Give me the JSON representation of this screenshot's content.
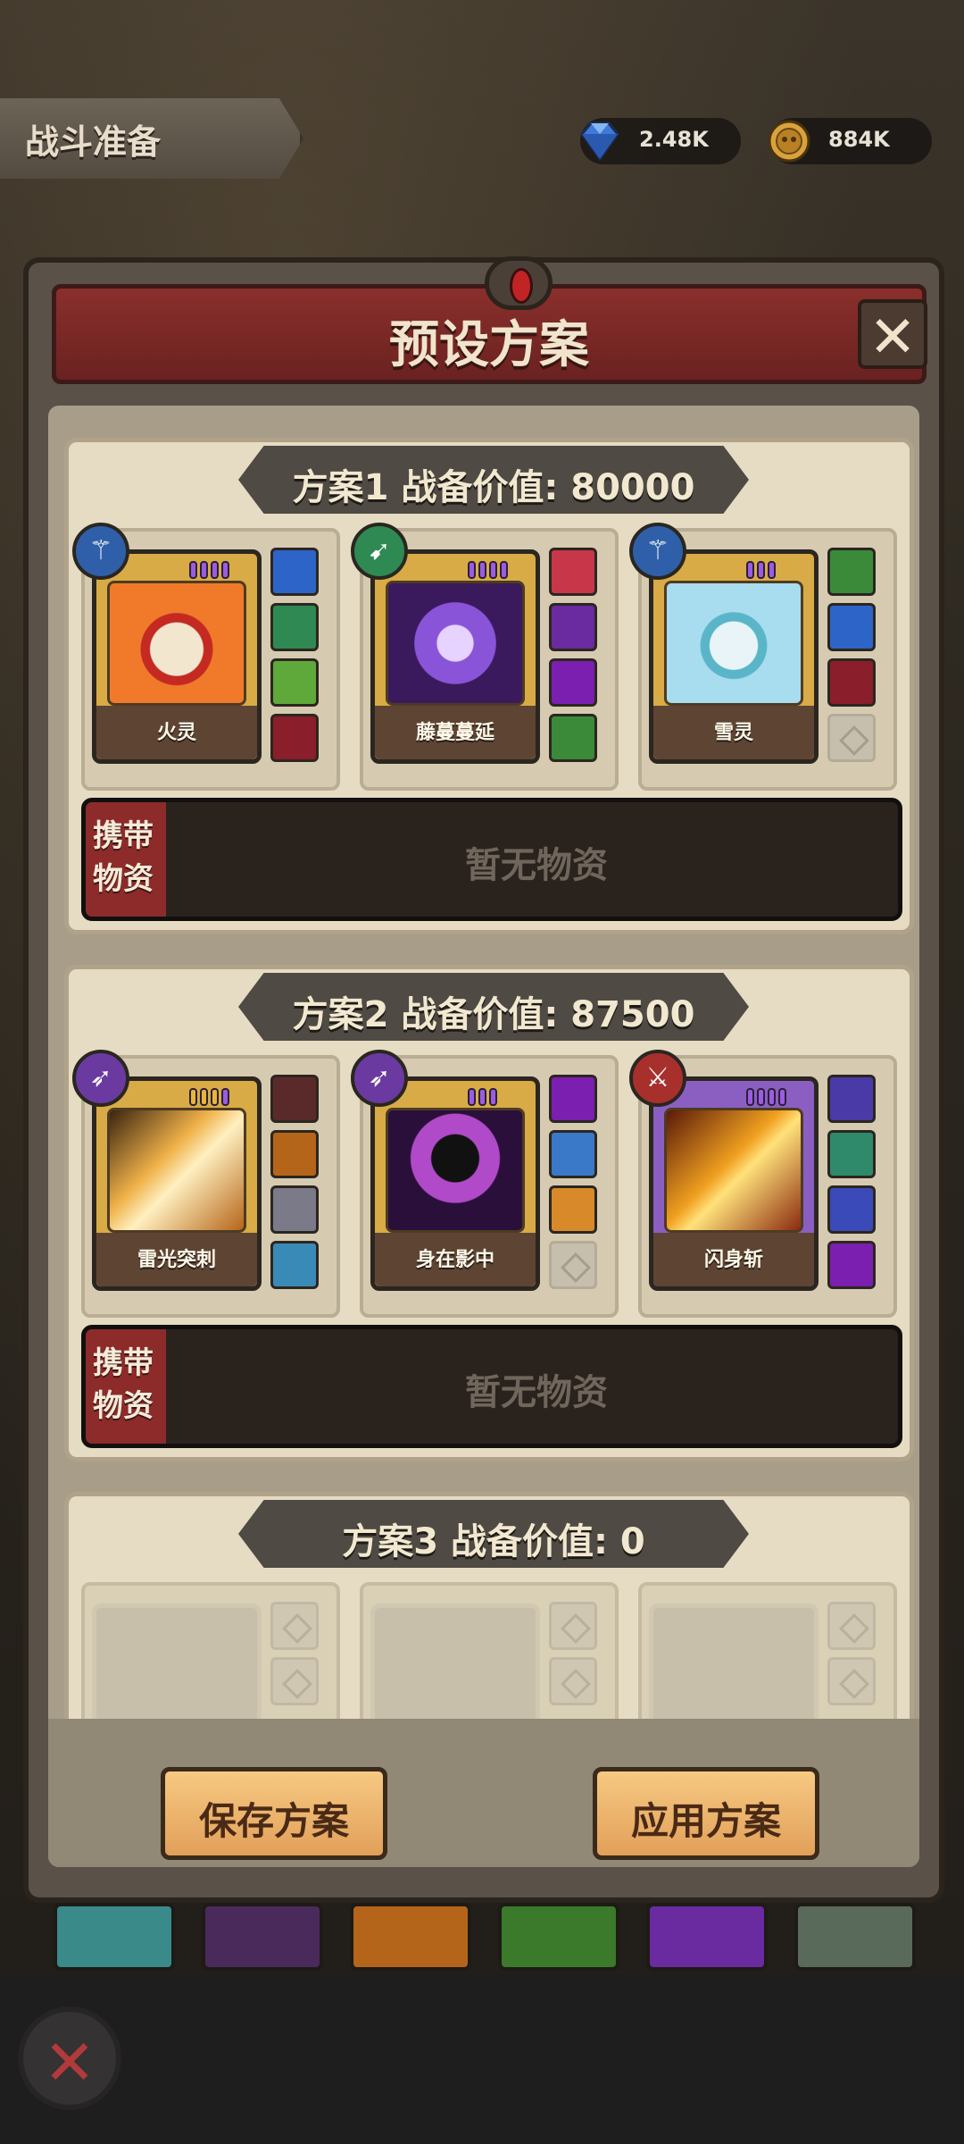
{
  "header": {
    "title": "战斗准备",
    "gems": "2.48K",
    "coins": "884K",
    "gem_icon": "diamond-icon",
    "coin_icon": "coin-icon"
  },
  "modal": {
    "title": "预设方案",
    "close_icon": "close-icon"
  },
  "plans": [
    {
      "label": "方案1   战备价值: 80000",
      "cards": [
        {
          "name": "火灵",
          "pips": 4,
          "badge": "ice-staff",
          "color": "#e85a2a"
        },
        {
          "name": "藤蔓蔓延",
          "pips": 4,
          "badge": "bow",
          "color": "#6a3aa8"
        },
        {
          "name": "雪灵",
          "pips": 3,
          "badge": "ice-staff",
          "color": "#6cc8e8"
        }
      ],
      "supplies_label": "携带物资",
      "supplies_text": "暂无物资"
    },
    {
      "label": "方案2   战备价值: 87500",
      "cards": [
        {
          "name": "雷光突刺",
          "pips": 4,
          "badge": "arrow",
          "color": "#c77a1a"
        },
        {
          "name": "身在影中",
          "pips": 3,
          "badge": "arrow",
          "color": "#6b2a7a"
        },
        {
          "name": "闪身斩",
          "pips": 4,
          "badge": "sword",
          "color": "#e8a020"
        }
      ],
      "supplies_label": "携带物资",
      "supplies_text": "暂无物资"
    },
    {
      "label": "方案3   战备价值: 0"
    }
  ],
  "actions": {
    "save": "保存方案",
    "apply": "应用方案"
  },
  "back_icon": "close-icon"
}
